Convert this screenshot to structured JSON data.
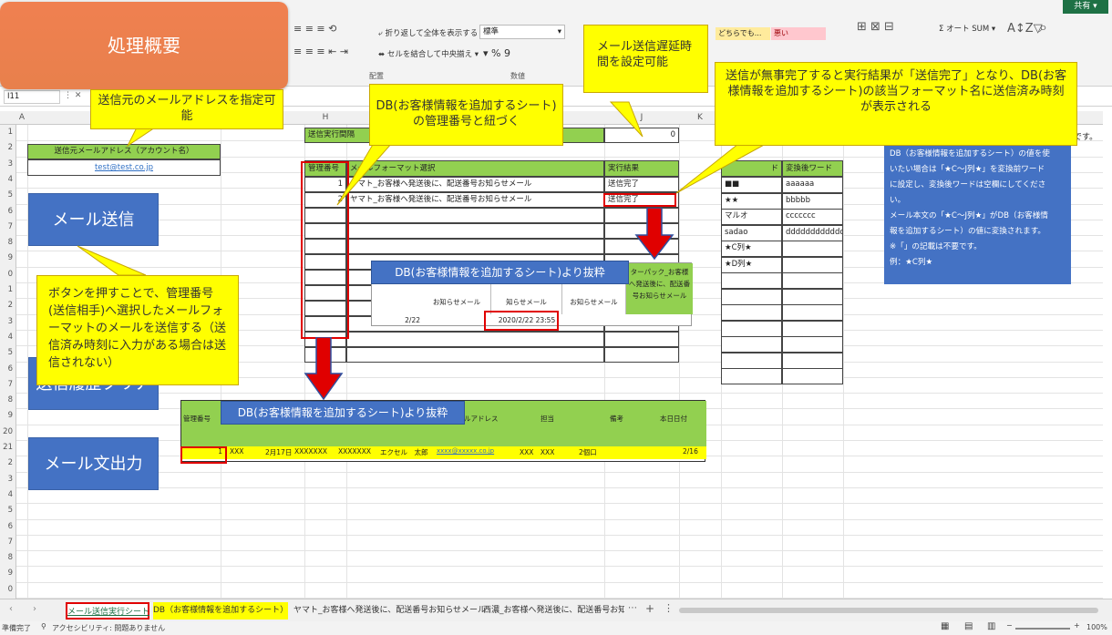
{
  "ribbon": {
    "share_label": "共有",
    "wrap_text": "折り返して全体を表示する",
    "merge_center": "セルを結合して中央揃え",
    "number_format": "標準",
    "percent": "%",
    "comma": "9",
    "group_align": "配置",
    "group_number": "数値",
    "style_neutral": "どちらでも...",
    "style_bad": "悪い",
    "autosum": "オート SUM"
  },
  "formula_bar": {
    "name_box": "I11"
  },
  "columns": [
    "A",
    "B",
    "H",
    "J",
    "K"
  ],
  "rows": [
    "1",
    "2",
    "3",
    "4",
    "5",
    "6",
    "7",
    "8",
    "9",
    "0",
    "1",
    "2",
    "3",
    "4",
    "5",
    "6",
    "7",
    "8",
    "9",
    "20",
    "21",
    "2",
    "3",
    "4",
    "5",
    "6",
    "7",
    "8",
    "9",
    "0"
  ],
  "title_badge": "処理概要",
  "sender": {
    "header": "送信元メールアドレス（アカウント名）",
    "value": "test@test.co.jp"
  },
  "interval": {
    "label": "送信実行間隔",
    "value": "0"
  },
  "main_table": {
    "headers": [
      "管理番号",
      "メールフォーマット選択",
      "実行結果"
    ],
    "rows": [
      {
        "num": "1",
        "format": "ヤマト_お客様へ発送後に、配送番号お知らせメール",
        "result": "送信完了"
      },
      {
        "num": "2",
        "format": "ヤマト_お客様へ発送後に、配送番号お知らせメール",
        "result": "送信完了"
      }
    ]
  },
  "replace_table": {
    "header_partial": "ド",
    "header_after": "変換後ワード",
    "rows": [
      {
        "before": "■■",
        "after": "aaaaaa"
      },
      {
        "before": "★★",
        "after": "bbbbb"
      },
      {
        "before": "マルオ",
        "after": "ccccccc"
      },
      {
        "before": "sadao",
        "after": "dddddddddddd"
      },
      {
        "before": "★C列★",
        "after": ""
      },
      {
        "before": "★D列★",
        "after": ""
      }
    ]
  },
  "notes": {
    "partial": "です。",
    "lines": [
      "DB（お客様情報を追加するシート）の値を使",
      "いたい場合は「★C〜J列★」を変換前ワード",
      "に設定し、変換後ワードは空欄にしてくださ",
      "い。",
      "メール本文の「★C〜J列★」がDB（お客様情",
      "報を追加するシート）の値に変換されます。",
      "※「」の記載は不要です。",
      "例：★C列★"
    ]
  },
  "extract1": {
    "title": "DB(お客様情報を追加するシート)より抜粋",
    "h1": "お知らせメール",
    "h2": "知らせメール",
    "h3": "お知らせメール",
    "h4": "ターパック_お客様へ発送後に、配送番号お知らせメール",
    "date": "2/22",
    "timestamp": "2020/2/22 23:55"
  },
  "extract2": {
    "title": "DB(お客様情報を追加するシート)より抜粋",
    "headers": [
      "管理番号",
      "ルアドレス",
      "担当",
      "備考",
      "本日日付"
    ],
    "row": [
      "1",
      "XXX",
      "2月17日",
      "XXXXXXX",
      "XXXXXXX",
      "エクセル　太郎",
      "xxxx@xxxxx.co.jp",
      "XXX　XXX",
      "2個口",
      "2/16"
    ]
  },
  "buttons": {
    "send": "メール送信",
    "history": "送信履歴クリア",
    "output": "メール文出力"
  },
  "callouts": {
    "sender": "送信元のメールアドレスを指定可能",
    "db_link": "DB(お客様情報を追加するシート)の管理番号と紐づく",
    "delay": "メール送信遅延時間を設定可能",
    "complete": "送信が無事完了すると実行結果が「送信完了」となり、DB(お客様情報を追加するシート)の該当フォーマット名に送信済み時刻が表示される",
    "button": "ボタンを押すことで、管理番号(送信相手)へ選択したメールフォーマットのメールを送信する（送信済み時刻に入力がある場合は送信されない）"
  },
  "tabs": [
    "メール送信実行シート",
    "DB（お客様情報を追加するシート）",
    "ヤマト_お客様へ発送後に、配送番号お知らせメール",
    "西濃_お客様へ発送後に、配送番号お知"
  ],
  "status": {
    "ready": "準備完了",
    "accessibility": "アクセシビリティ: 問題ありません",
    "zoom": "100%"
  },
  "colors": {
    "accent_blue": "#4472c4",
    "callout_yellow": "#ffff00",
    "header_green": "#92d050",
    "highlight_red": "#e00000",
    "badge_orange": "#f08050"
  }
}
